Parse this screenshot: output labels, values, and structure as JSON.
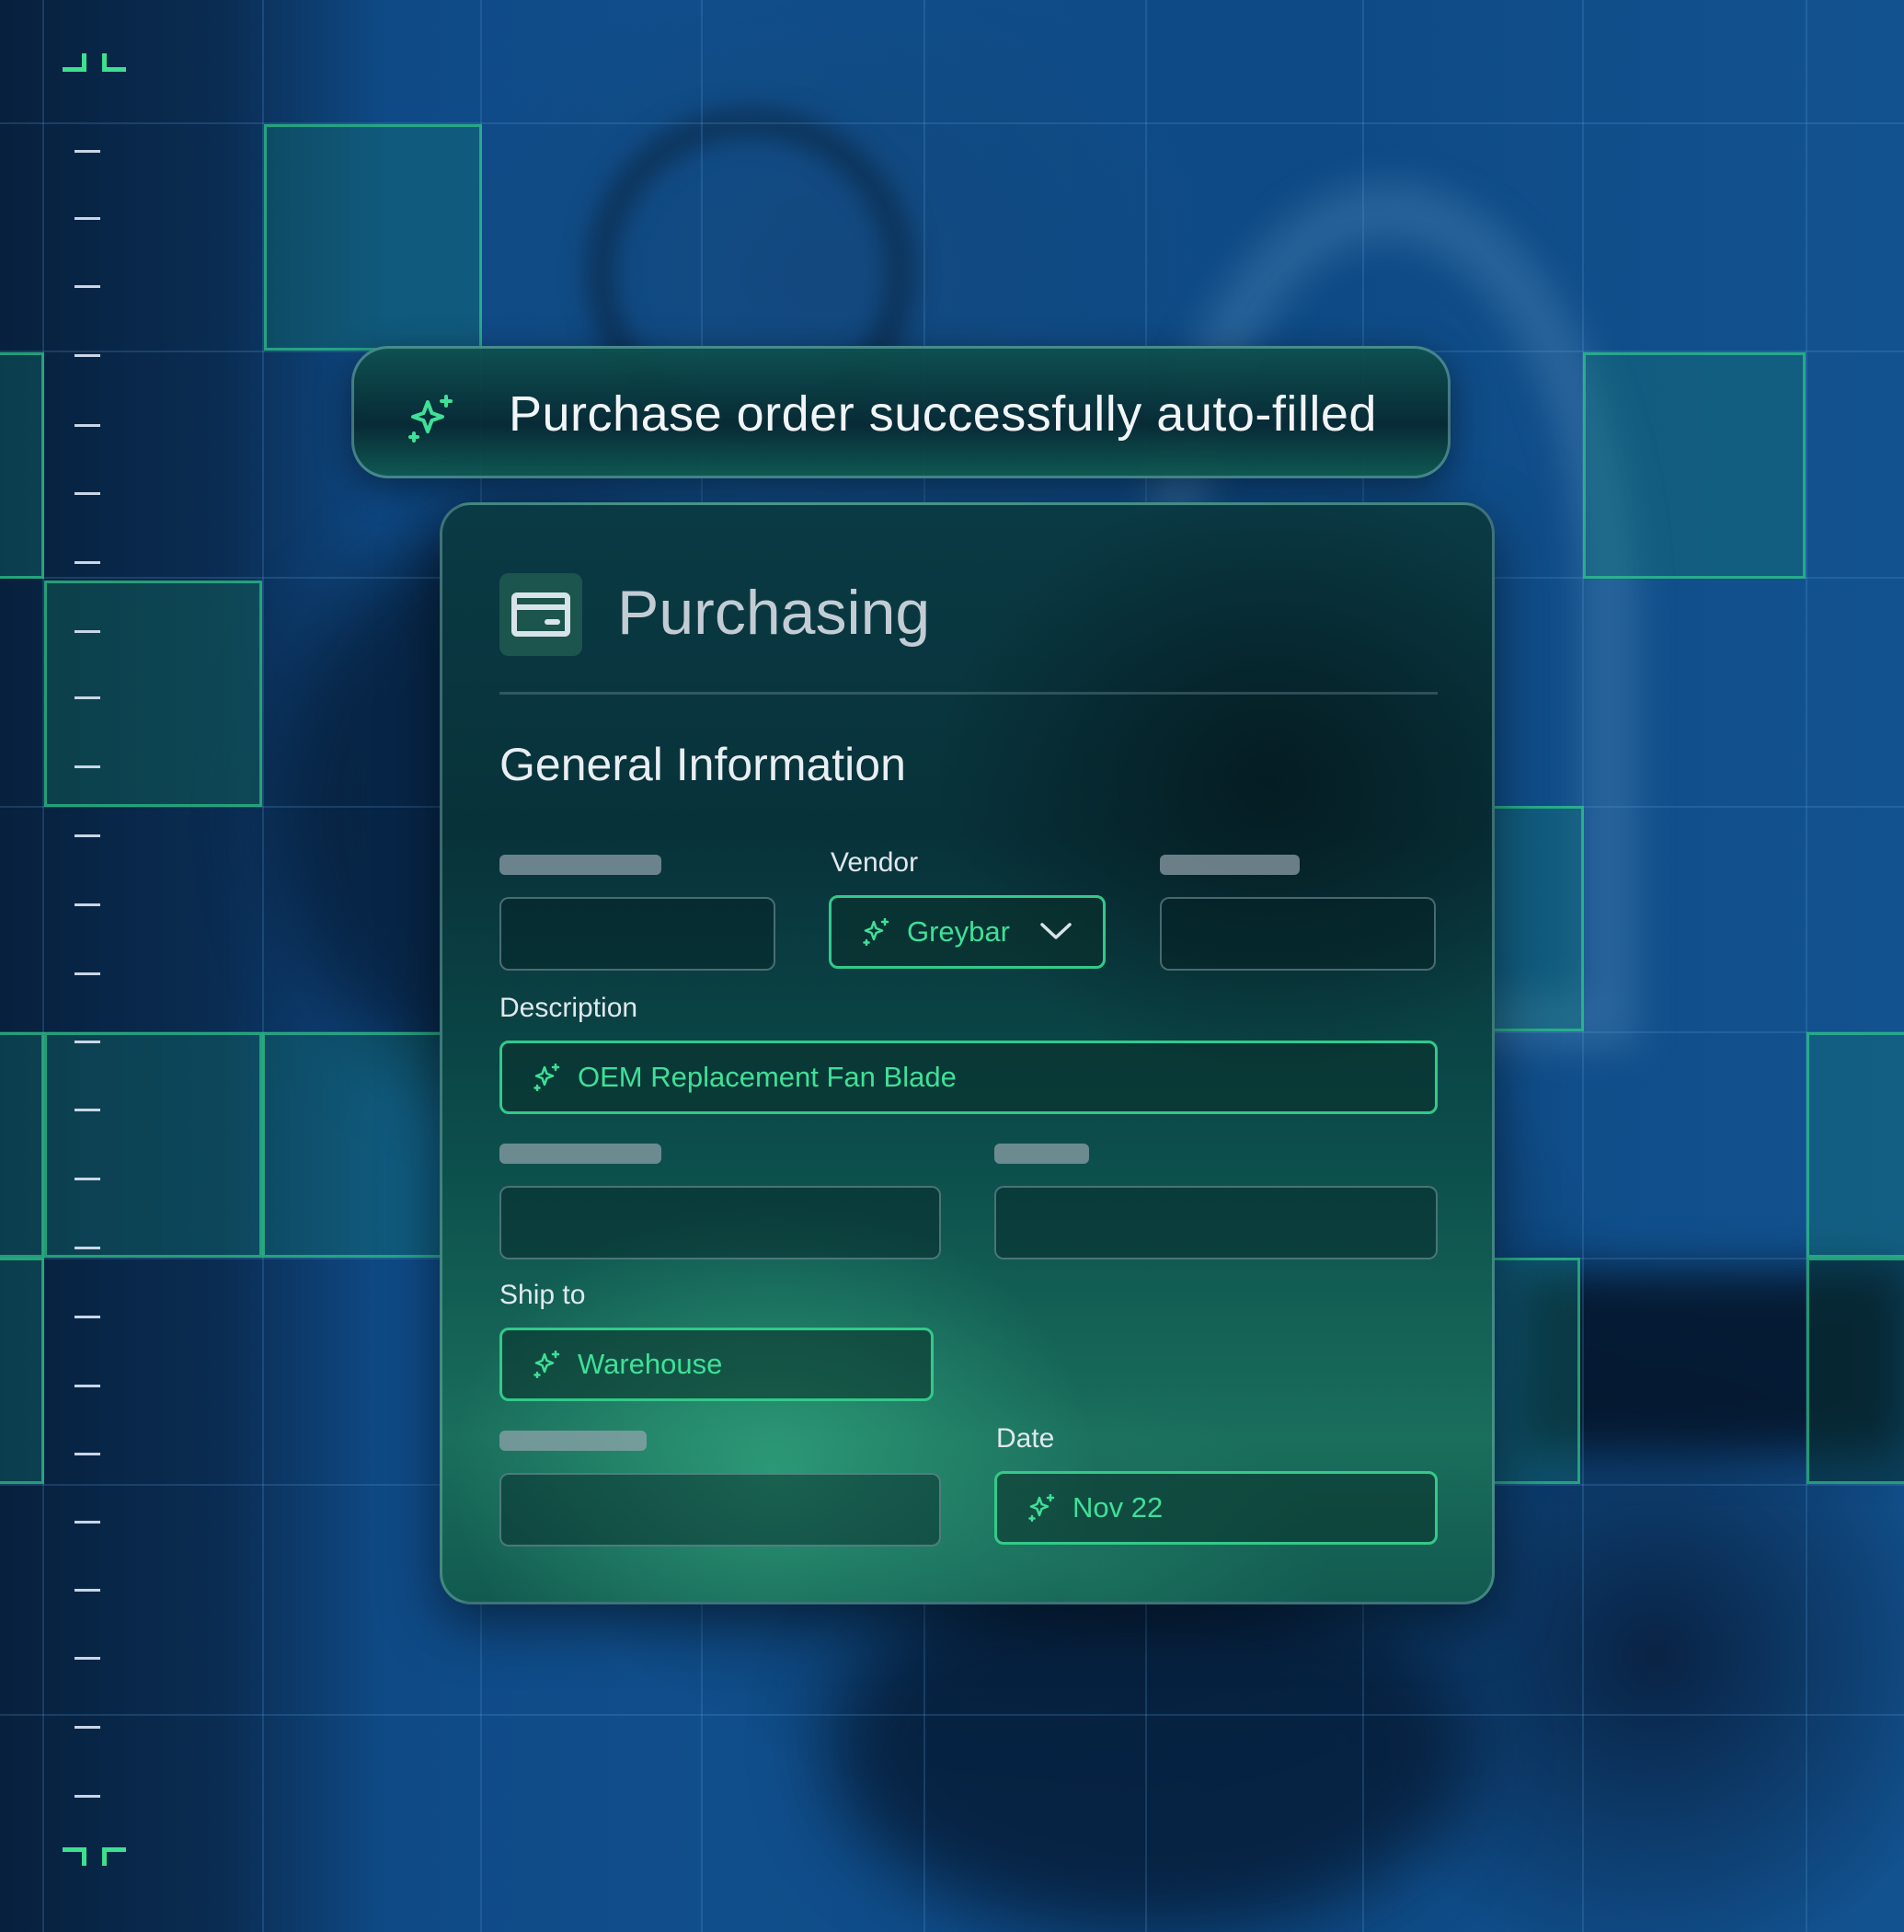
{
  "toast": {
    "message": "Purchase order successfully auto-filled",
    "icon": "sparkle-icon"
  },
  "panel": {
    "title": "Purchasing",
    "header_icon": "credit-card-icon",
    "section_title": "General Information",
    "fields": {
      "vendor": {
        "label": "Vendor",
        "value": "Greybar",
        "icon": "sparkle-icon",
        "control": "dropdown"
      },
      "description": {
        "label": "Description",
        "value": "OEM Replacement Fan Blade",
        "icon": "sparkle-icon"
      },
      "ship_to": {
        "label": "Ship to",
        "value": "Warehouse",
        "icon": "sparkle-icon"
      },
      "date": {
        "label": "Date",
        "value": "Nov 22",
        "icon": "sparkle-icon"
      }
    }
  },
  "colors": {
    "accent_green": "#3fe098",
    "filled_border": "#33c98a",
    "background_blue": "#104e8b",
    "panel_dark_teal": "#08323a",
    "tile_border": "#30d28c"
  }
}
